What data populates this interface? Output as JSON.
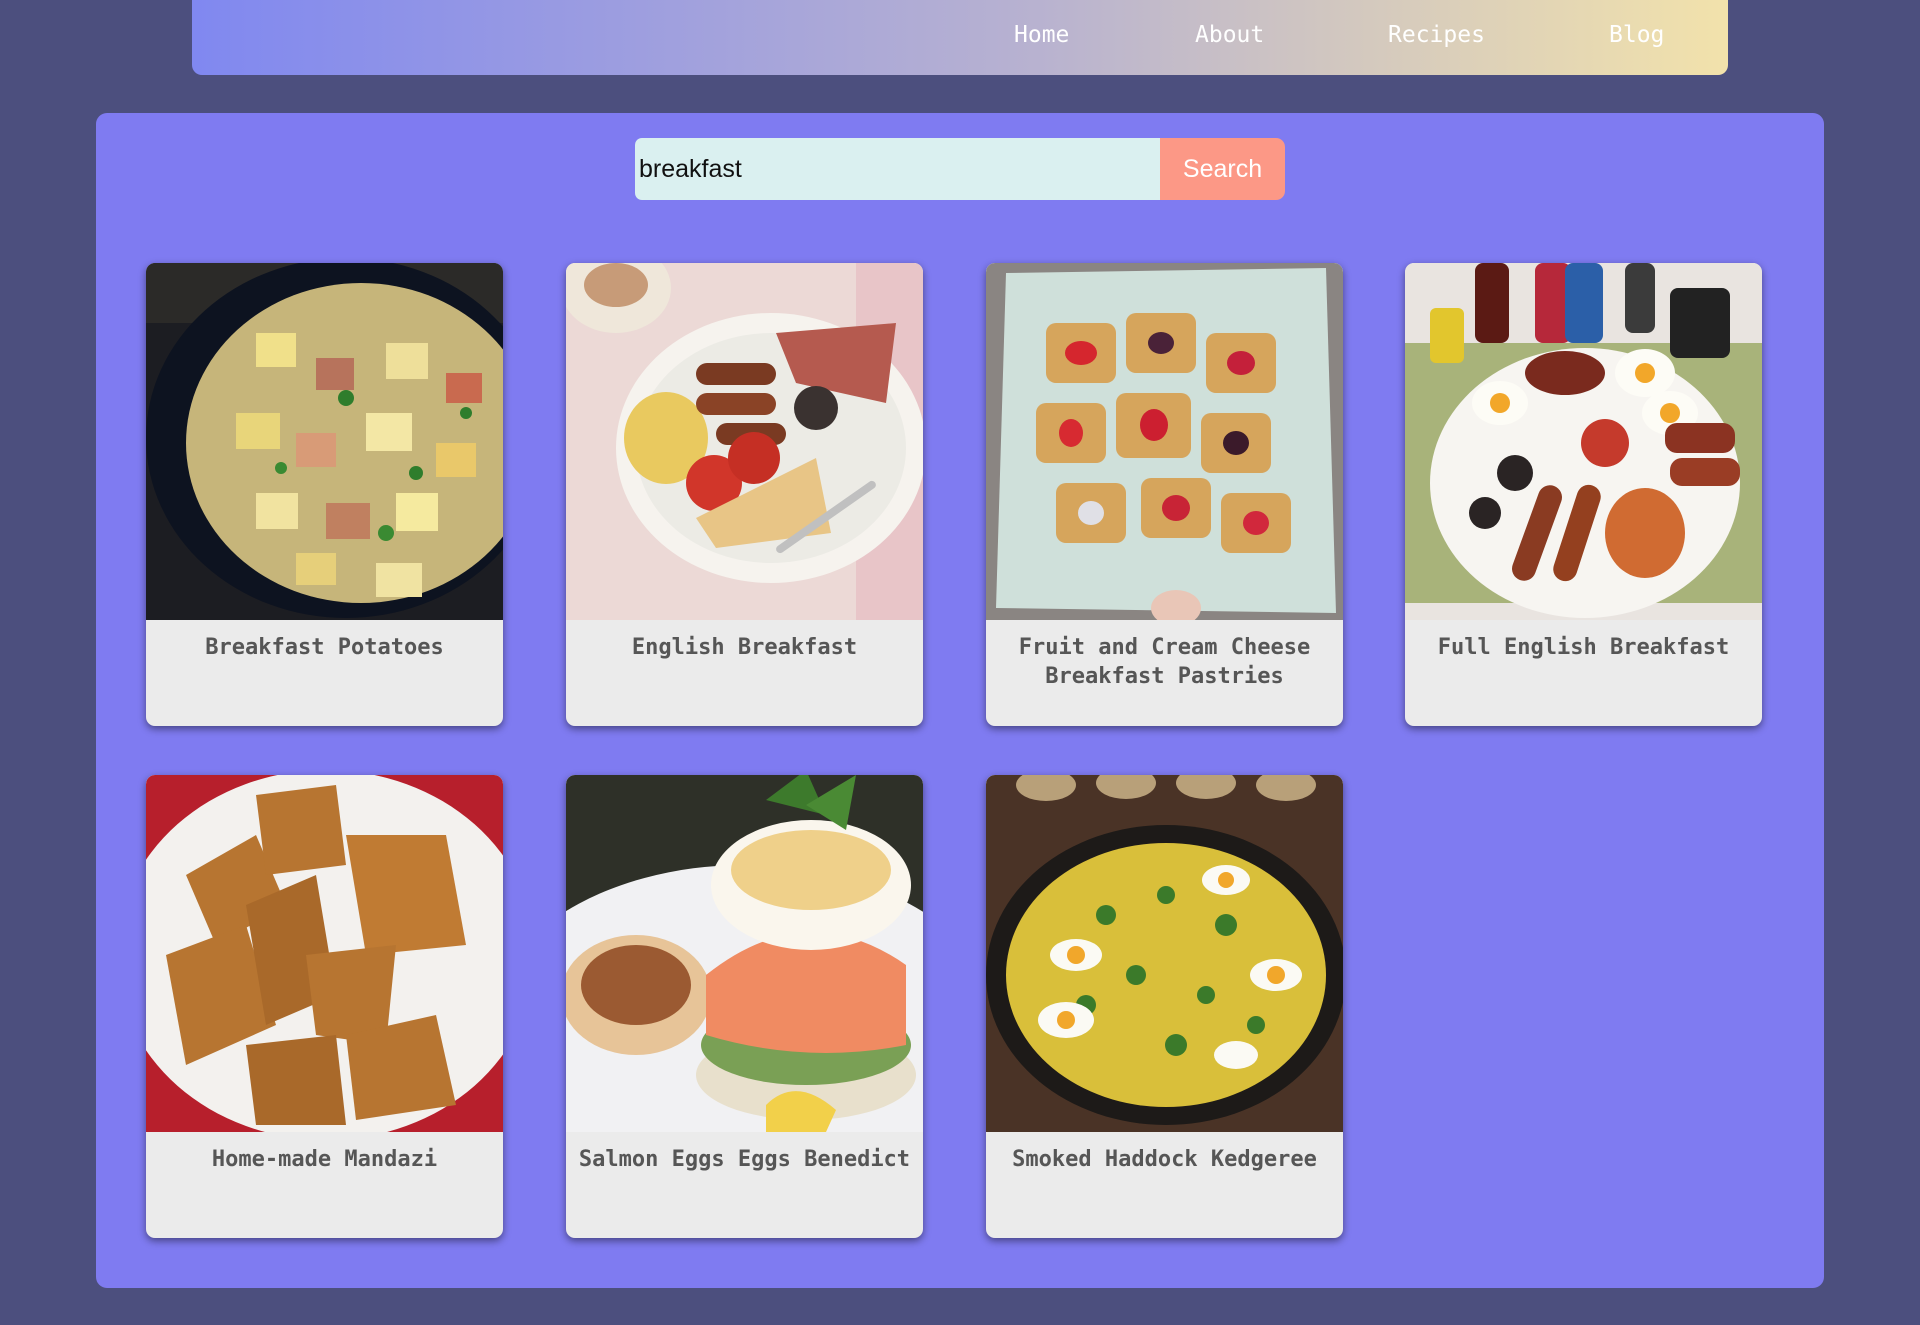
{
  "nav": {
    "links": [
      {
        "label": "Home"
      },
      {
        "label": "About"
      },
      {
        "label": "Recipes"
      },
      {
        "label": "Blog"
      }
    ]
  },
  "search": {
    "value": "breakfast",
    "button_label": "Search"
  },
  "recipes": [
    {
      "title": "Breakfast Potatoes",
      "image": "skillet-potatoes-photo"
    },
    {
      "title": "English Breakfast",
      "image": "english-breakfast-plate-photo"
    },
    {
      "title": "Fruit and Cream Cheese Breakfast Pastries",
      "image": "fruit-pastries-photo"
    },
    {
      "title": "Full English Breakfast",
      "image": "full-english-breakfast-photo"
    },
    {
      "title": "Home-made Mandazi",
      "image": "mandazi-photo"
    },
    {
      "title": "Salmon Eggs Eggs Benedict",
      "image": "salmon-eggs-benedict-photo"
    },
    {
      "title": "Smoked Haddock Kedgeree",
      "image": "kedgeree-photo"
    }
  ],
  "colors": {
    "page_background": "#4c4f7e",
    "panel_background": "#7f7bf1",
    "search_button": "#fc9886",
    "search_input": "#daf0f0",
    "card_background": "#ebebeb"
  }
}
